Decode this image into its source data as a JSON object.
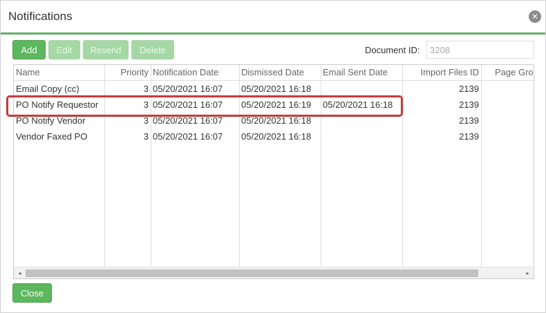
{
  "dialog": {
    "title": "Notifications",
    "close_icon": "close-circle-icon"
  },
  "toolbar": {
    "add_label": "Add",
    "edit_label": "Edit",
    "resend_label": "Resend",
    "delete_label": "Delete"
  },
  "document_id": {
    "label": "Document ID:",
    "value": "3208"
  },
  "grid": {
    "columns": [
      "Name",
      "Priority",
      "Notification Date",
      "Dismissed Date",
      "Email Sent Date",
      "Import Files ID",
      "Page Gro"
    ],
    "rows": [
      {
        "name": "Email Copy (cc)",
        "priority": "3",
        "notification_date": "05/20/2021 16:07",
        "dismissed_date": "05/20/2021 16:18",
        "email_sent_date": "",
        "import_files_id": "2139",
        "page_group": ""
      },
      {
        "name": "PO Notify Requestor",
        "priority": "3",
        "notification_date": "05/20/2021 16:07",
        "dismissed_date": "05/20/2021 16:19",
        "email_sent_date": "05/20/2021 16:18",
        "import_files_id": "2139",
        "page_group": ""
      },
      {
        "name": "PO Notify Vendor",
        "priority": "3",
        "notification_date": "05/20/2021 16:07",
        "dismissed_date": "05/20/2021 16:18",
        "email_sent_date": "",
        "import_files_id": "2139",
        "page_group": ""
      },
      {
        "name": "Vendor Faxed PO",
        "priority": "3",
        "notification_date": "05/20/2021 16:07",
        "dismissed_date": "05/20/2021 16:18",
        "email_sent_date": "",
        "import_files_id": "2139",
        "page_group": ""
      }
    ],
    "highlighted_row": 1
  },
  "scrollbar": {
    "left_arrow": "◂",
    "right_arrow": "▸"
  },
  "footer": {
    "close_label": "Close"
  },
  "colors": {
    "accent": "#5cb85c",
    "highlight": "#e03030"
  }
}
